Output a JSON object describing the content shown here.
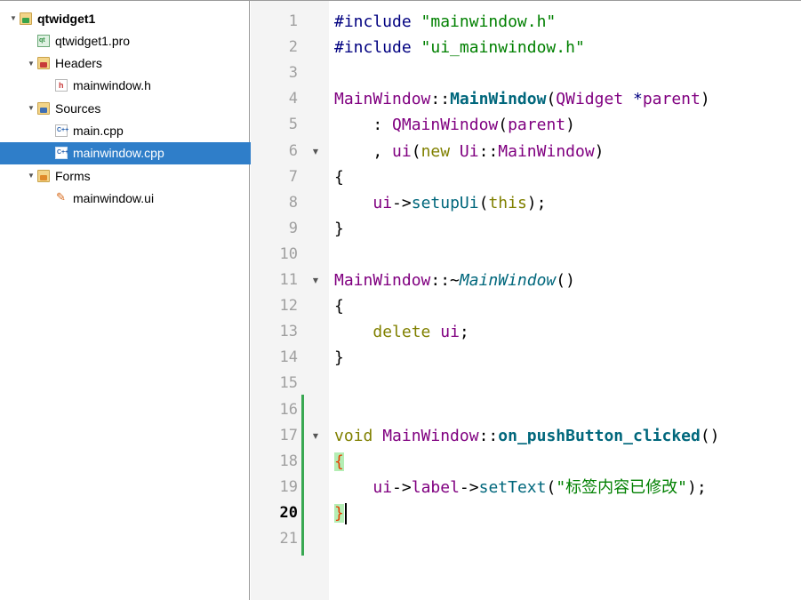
{
  "project_tree": {
    "items": [
      {
        "label": "qtwidget1",
        "level": 0,
        "expanded": true,
        "icon": "project-folder-icon",
        "bold": true
      },
      {
        "label": "qtwidget1.pro",
        "level": 1,
        "icon": "pro-file-icon"
      },
      {
        "label": "Headers",
        "level": 1,
        "expanded": true,
        "icon": "headers-folder-icon"
      },
      {
        "label": "mainwindow.h",
        "level": 2,
        "icon": "header-file-icon"
      },
      {
        "label": "Sources",
        "level": 1,
        "expanded": true,
        "icon": "sources-folder-icon"
      },
      {
        "label": "main.cpp",
        "level": 2,
        "icon": "cpp-file-icon"
      },
      {
        "label": "mainwindow.cpp",
        "level": 2,
        "icon": "cpp-file-icon",
        "selected": true
      },
      {
        "label": "Forms",
        "level": 1,
        "expanded": true,
        "icon": "forms-folder-icon"
      },
      {
        "label": "mainwindow.ui",
        "level": 2,
        "icon": "ui-file-icon"
      }
    ]
  },
  "editor": {
    "current_line": 20,
    "fold_markers": [
      6,
      11,
      17
    ],
    "changed_lines": [
      16,
      21
    ],
    "lines": [
      {
        "n": "1",
        "tokens": [
          [
            "pp",
            "#include "
          ],
          [
            "str",
            "\"mainwindow.h\""
          ]
        ]
      },
      {
        "n": "2",
        "tokens": [
          [
            "pp",
            "#include "
          ],
          [
            "str",
            "\"ui_mainwindow.h\""
          ]
        ]
      },
      {
        "n": "3",
        "tokens": []
      },
      {
        "n": "4",
        "tokens": [
          [
            "ty",
            "MainWindow"
          ],
          [
            "br",
            "::"
          ],
          [
            "fnb",
            "MainWindow"
          ],
          [
            "br",
            "("
          ],
          [
            "ty",
            "QWidget"
          ],
          [
            "br",
            " "
          ],
          [
            "pp",
            "*"
          ],
          [
            "ty",
            "parent"
          ],
          [
            "br",
            ")"
          ]
        ]
      },
      {
        "n": "5",
        "tokens": [
          [
            "br",
            "    : "
          ],
          [
            "ty",
            "QMainWindow"
          ],
          [
            "br",
            "("
          ],
          [
            "ty",
            "parent"
          ],
          [
            "br",
            ")"
          ]
        ]
      },
      {
        "n": "6",
        "tokens": [
          [
            "br",
            "    , "
          ],
          [
            "ty",
            "ui"
          ],
          [
            "br",
            "("
          ],
          [
            "kw",
            "new"
          ],
          [
            "br",
            " "
          ],
          [
            "ty",
            "Ui"
          ],
          [
            "br",
            "::"
          ],
          [
            "ty",
            "MainWindow"
          ],
          [
            "br",
            ")"
          ]
        ]
      },
      {
        "n": "7",
        "tokens": [
          [
            "br",
            "{"
          ]
        ]
      },
      {
        "n": "8",
        "tokens": [
          [
            "br",
            "    "
          ],
          [
            "ty",
            "ui"
          ],
          [
            "br",
            "->"
          ],
          [
            "fn",
            "setupUi"
          ],
          [
            "br",
            "("
          ],
          [
            "kw",
            "this"
          ],
          [
            "br",
            ");"
          ]
        ]
      },
      {
        "n": "9",
        "tokens": [
          [
            "br",
            "}"
          ]
        ]
      },
      {
        "n": "10",
        "tokens": []
      },
      {
        "n": "11",
        "tokens": [
          [
            "ty",
            "MainWindow"
          ],
          [
            "br",
            "::~"
          ],
          [
            "fni",
            "MainWindow"
          ],
          [
            "br",
            "()"
          ]
        ]
      },
      {
        "n": "12",
        "tokens": [
          [
            "br",
            "{"
          ]
        ]
      },
      {
        "n": "13",
        "tokens": [
          [
            "br",
            "    "
          ],
          [
            "kw",
            "delete"
          ],
          [
            "br",
            " "
          ],
          [
            "ty",
            "ui"
          ],
          [
            "br",
            ";"
          ]
        ]
      },
      {
        "n": "14",
        "tokens": [
          [
            "br",
            "}"
          ]
        ]
      },
      {
        "n": "15",
        "tokens": []
      },
      {
        "n": "16",
        "tokens": []
      },
      {
        "n": "17",
        "tokens": [
          [
            "kw",
            "void"
          ],
          [
            "br",
            " "
          ],
          [
            "ty",
            "MainWindow"
          ],
          [
            "br",
            "::"
          ],
          [
            "fnb",
            "on_pushButton_clicked"
          ],
          [
            "br",
            "()"
          ]
        ]
      },
      {
        "n": "18",
        "tokens": [
          [
            "hl",
            "{"
          ]
        ]
      },
      {
        "n": "19",
        "tokens": [
          [
            "br",
            "    "
          ],
          [
            "ty",
            "ui"
          ],
          [
            "br",
            "->"
          ],
          [
            "ty",
            "label"
          ],
          [
            "br",
            "->"
          ],
          [
            "fn",
            "setText"
          ],
          [
            "br",
            "("
          ],
          [
            "str",
            "\"标签内容已修改\""
          ],
          [
            "br",
            ");"
          ]
        ]
      },
      {
        "n": "20",
        "tokens": [
          [
            "hl",
            "}"
          ],
          [
            "caret",
            ""
          ]
        ]
      },
      {
        "n": "21",
        "tokens": []
      }
    ]
  },
  "colors": {
    "selection": "#2f7ec9",
    "gutter": "#f4f4f4",
    "change_marker": "#39a852",
    "brace_match_bg": "#b4eeb4",
    "brace_match_fg": "#e63d00",
    "preprocessor": "#000080",
    "string": "#008000",
    "keyword": "#808000",
    "type": "#800080",
    "function": "#00677c"
  }
}
